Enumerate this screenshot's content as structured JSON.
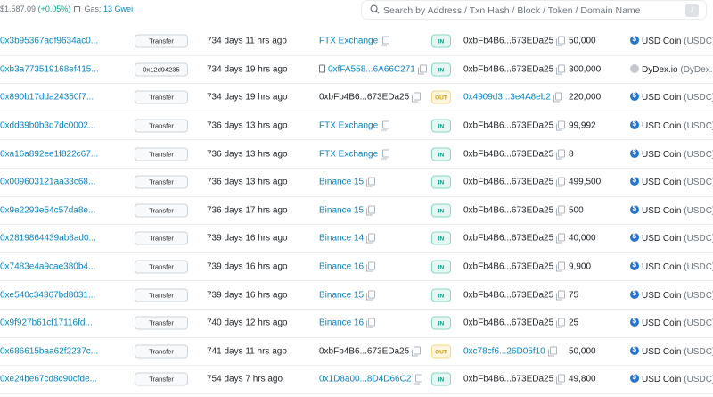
{
  "header": {
    "price": "$1,587.09",
    "price_change": "(+0.05%)",
    "gas_label": "Gas:",
    "gas_value": "13 Gwei"
  },
  "search": {
    "placeholder": "Search by Address / Txn Hash / Block / Token / Domain Name",
    "shortcut": "/"
  },
  "rows": [
    {
      "hash": "0x3b95367adf9634ac0...",
      "method": "Transfer",
      "age": "734 days 11 hrs ago",
      "from": "FTX Exchange",
      "from_type": "link",
      "dir": "IN",
      "to": "0xbFb4B6...673EDa25",
      "to_type": "plain",
      "qty": "50,000",
      "token": "USD Coin",
      "sym": "(USDC)"
    },
    {
      "hash": "0xb3a773519168ef415...",
      "method": "0x12d94235",
      "age": "734 days 19 hrs ago",
      "from": "0xfFA558...6A66C271",
      "from_type": "contract",
      "dir": "IN",
      "to": "0xbFb4B6...673EDa25",
      "to_type": "plain",
      "qty": "300,000",
      "token": "DyDex.io",
      "sym": "(DyDex...",
      "coin": "dydex"
    },
    {
      "hash": "0x890b17dda24350f7...",
      "method": "Transfer",
      "age": "734 days 19 hrs ago",
      "from": "0xbFb4B6...673EDa25",
      "from_type": "plain",
      "dir": "OUT",
      "to": "0x4909d3...3e4A8eb2",
      "to_type": "link",
      "qty": "220,000",
      "token": "USD Coin",
      "sym": "(USDC)"
    },
    {
      "hash": "0xdd39b0b3d7dc0002...",
      "method": "Transfer",
      "age": "736 days 13 hrs ago",
      "from": "FTX Exchange",
      "from_type": "link",
      "dir": "IN",
      "to": "0xbFb4B6...673EDa25",
      "to_type": "plain",
      "qty": "99,992",
      "token": "USD Coin",
      "sym": "(USDC)"
    },
    {
      "hash": "0xa16a892ee1f822c67...",
      "method": "Transfer",
      "age": "736 days 13 hrs ago",
      "from": "FTX Exchange",
      "from_type": "link",
      "dir": "IN",
      "to": "0xbFb4B6...673EDa25",
      "to_type": "plain",
      "qty": "8",
      "token": "USD Coin",
      "sym": "(USDC)"
    },
    {
      "hash": "0x009603121aa33c68...",
      "method": "Transfer",
      "age": "736 days 13 hrs ago",
      "from": "Binance 15",
      "from_type": "link",
      "dir": "IN",
      "to": "0xbFb4B6...673EDa25",
      "to_type": "plain",
      "qty": "499,500",
      "token": "USD Coin",
      "sym": "(USDC)"
    },
    {
      "hash": "0x9e2293e54c57da8e...",
      "method": "Transfer",
      "age": "736 days 17 hrs ago",
      "from": "Binance 15",
      "from_type": "link",
      "dir": "IN",
      "to": "0xbFb4B6...673EDa25",
      "to_type": "plain",
      "qty": "500",
      "token": "USD Coin",
      "sym": "(USDC)"
    },
    {
      "hash": "0x2819864439ab8ad0...",
      "method": "Transfer",
      "age": "739 days 16 hrs ago",
      "from": "Binance 14",
      "from_type": "link",
      "dir": "IN",
      "to": "0xbFb4B6...673EDa25",
      "to_type": "plain",
      "qty": "40,000",
      "token": "USD Coin",
      "sym": "(USDC)"
    },
    {
      "hash": "0x7483e4a9cae380b4...",
      "method": "Transfer",
      "age": "739 days 16 hrs ago",
      "from": "Binance 16",
      "from_type": "link",
      "dir": "IN",
      "to": "0xbFb4B6...673EDa25",
      "to_type": "plain",
      "qty": "9,900",
      "token": "USD Coin",
      "sym": "(USDC)"
    },
    {
      "hash": "0xe540c34367bd8031...",
      "method": "Transfer",
      "age": "739 days 16 hrs ago",
      "from": "Binance 15",
      "from_type": "link",
      "dir": "IN",
      "to": "0xbFb4B6...673EDa25",
      "to_type": "plain",
      "qty": "75",
      "token": "USD Coin",
      "sym": "(USDC)"
    },
    {
      "hash": "0x9f927b61cf17116fd...",
      "method": "Transfer",
      "age": "740 days 12 hrs ago",
      "from": "Binance 16",
      "from_type": "link",
      "dir": "IN",
      "to": "0xbFb4B6...673EDa25",
      "to_type": "plain",
      "qty": "25",
      "token": "USD Coin",
      "sym": "(USDC)"
    },
    {
      "hash": "0x686615baa62f2237c...",
      "method": "Transfer",
      "age": "741 days 11 hrs ago",
      "from": "0xbFb4B6...673EDa25",
      "from_type": "plain",
      "dir": "OUT",
      "to": "0xc78cf6...26D05f10",
      "to_type": "link",
      "qty": "50,000",
      "token": "USD Coin",
      "sym": "(USDC)"
    },
    {
      "hash": "0xe24be67cd8c90cfde...",
      "method": "Transfer",
      "age": "754 days 7 hrs ago",
      "from": "0x1D8a00...8D4D66C2",
      "from_type": "link",
      "dir": "IN",
      "to": "0xbFb4B6...673EDa25",
      "to_type": "plain",
      "qty": "49,800",
      "token": "USD Coin",
      "sym": "(USDC)"
    }
  ]
}
